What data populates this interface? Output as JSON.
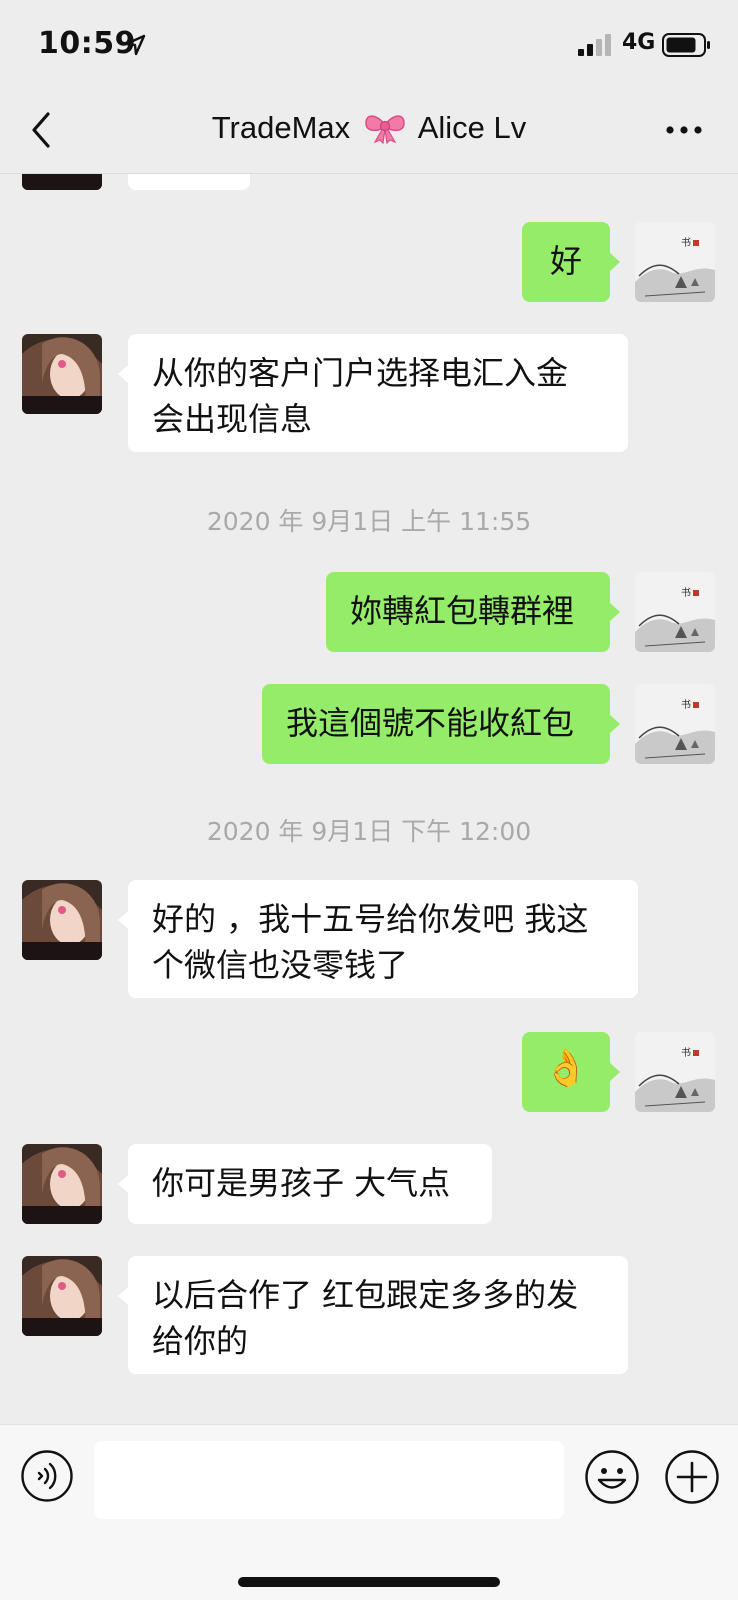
{
  "status_bar": {
    "time": "10:59",
    "network": "4G"
  },
  "header": {
    "title_left": "TradeMax",
    "title_right": "Alice Lv"
  },
  "messages": [
    {
      "id": "m1",
      "from": "me",
      "text": "好"
    },
    {
      "id": "m2",
      "from": "her",
      "text_line1": "从你的客户门户选择电汇入金",
      "text_line2": "会出现信息"
    },
    {
      "id": "t1",
      "timestamp": "2020 年 9月1日 上午 11:55"
    },
    {
      "id": "m3",
      "from": "me",
      "text": "妳轉紅包轉群裡"
    },
    {
      "id": "m4",
      "from": "me",
      "text": "我這個號不能收紅包"
    },
    {
      "id": "t2",
      "timestamp": "2020 年 9月1日 下午 12:00"
    },
    {
      "id": "m5",
      "from": "her",
      "text_line1": "好的 ，我十五号给你发吧 我这",
      "text_line2": "个微信也没零钱了"
    },
    {
      "id": "m6",
      "from": "me",
      "emoji": "👌"
    },
    {
      "id": "m7",
      "from": "her",
      "text": "你可是男孩子 大气点"
    },
    {
      "id": "m8",
      "from": "her",
      "text_line1": "以后合作了 红包跟定多多的发",
      "text_line2": "给你的"
    }
  ],
  "input": {
    "value": ""
  },
  "icons": {
    "back": "chevron-left-icon",
    "more": "more-dots-icon",
    "voice": "voice-icon",
    "emoji": "emoji-icon",
    "plus": "plus-icon"
  },
  "colors": {
    "background": "#ededed",
    "outgoing_bubble": "#95ec69",
    "incoming_bubble": "#ffffff",
    "timestamp": "#a9a9a9"
  }
}
